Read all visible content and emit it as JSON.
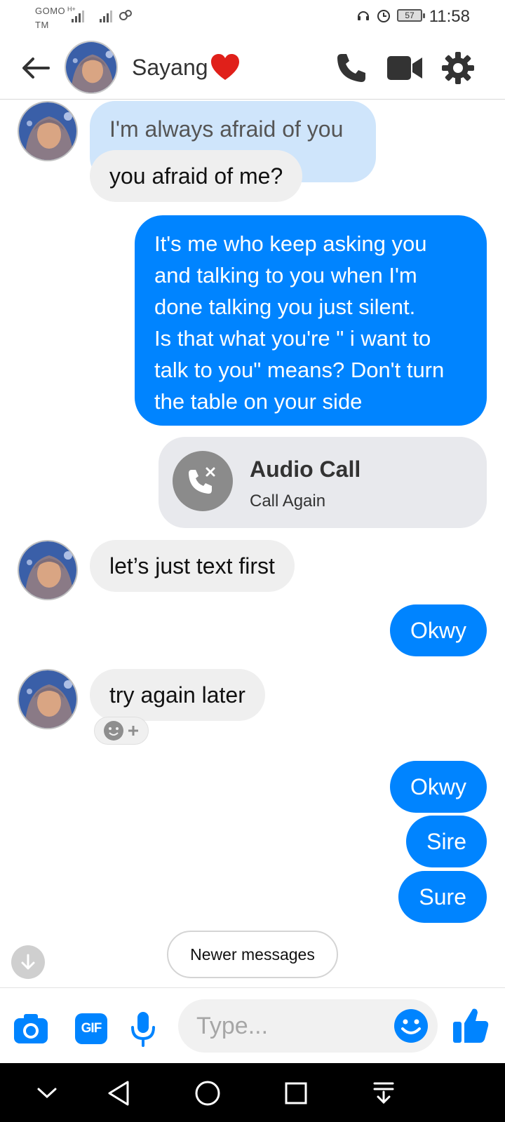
{
  "status_bar": {
    "carrier_line1": "GOMO",
    "carrier_line2": "TM",
    "network_type": "H+",
    "battery": "57",
    "time": "11:58"
  },
  "header": {
    "contact_name": "Sayang",
    "icons": [
      "back-arrow-icon",
      "phone-icon",
      "video-camera-icon",
      "gear-icon"
    ]
  },
  "messages": {
    "m1": "I'm always afraid of you",
    "m2": "you afraid of me?",
    "m3_lines": [
      "It's me who keep asking you",
      "and talking to you when I'm",
      "done talking you just silent.",
      "Is that what you're \" i want to",
      "talk to you\" means? Don't turn",
      "the table on your side"
    ],
    "m4": "let’s just text first",
    "m5": "Okwy",
    "m6": "try again later",
    "m7": "Okwy",
    "m8": "Sire",
    "m9": "Sure"
  },
  "call_card": {
    "title": "Audio Call",
    "action": "Call Again"
  },
  "newer_messages": "Newer messages",
  "composer": {
    "gif_label": "GIF",
    "placeholder": "Type..."
  },
  "colors": {
    "messenger_blue": "#0084ff",
    "incoming_gray": "#efefef",
    "header_icons": "#333333"
  }
}
